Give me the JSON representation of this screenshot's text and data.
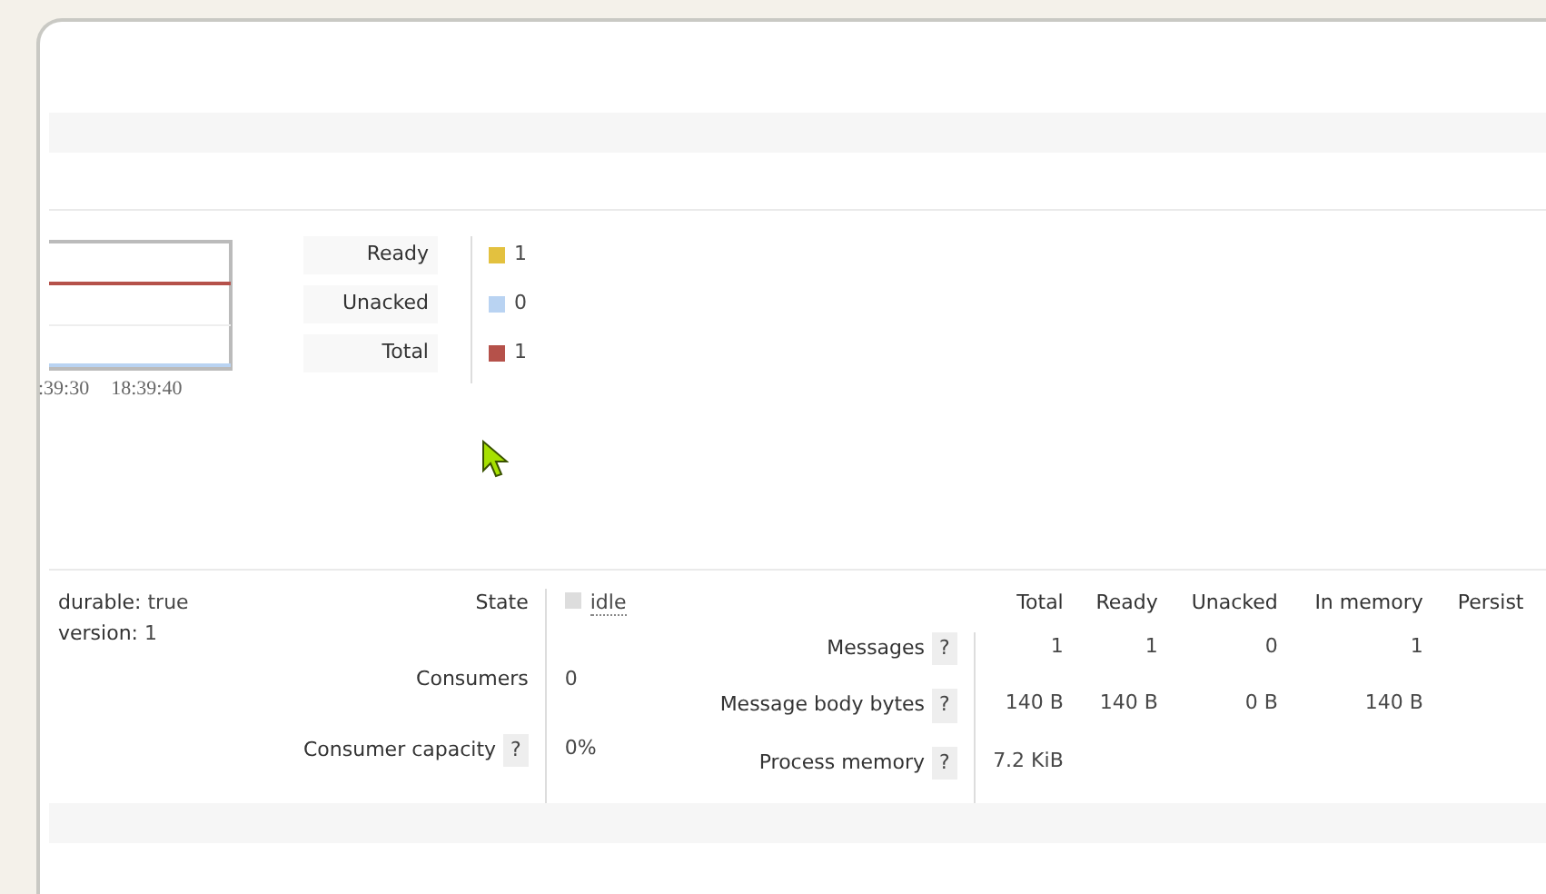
{
  "queue_chart": {
    "tick_labels": [
      ":39:30",
      "18:39:40"
    ],
    "legend": [
      {
        "label": "Ready",
        "value": "1",
        "color": "#e3c13f"
      },
      {
        "label": "Unacked",
        "value": "0",
        "color": "#b9d3f2"
      },
      {
        "label": "Total",
        "value": "1",
        "color": "#b5514a"
      }
    ]
  },
  "features": [
    {
      "label": "durable:",
      "value": "true"
    },
    {
      "label": "version:",
      "value": "1"
    }
  ],
  "status": [
    {
      "label": "State",
      "value": "idle",
      "kind": "state"
    },
    {
      "label": "Consumers",
      "value": "0",
      "kind": "text"
    },
    {
      "label": "Consumer capacity",
      "help": "?",
      "value": "0%",
      "kind": "text"
    }
  ],
  "messages": {
    "columns": [
      "Total",
      "Ready",
      "Unacked",
      "In memory",
      "Persist"
    ],
    "rows": [
      {
        "label": "Messages",
        "help": "?",
        "cells": [
          "1",
          "1",
          "0",
          "1"
        ]
      },
      {
        "label": "Message body bytes",
        "help": "?",
        "cells": [
          "140 B",
          "140 B",
          "0 B",
          "140 B"
        ]
      },
      {
        "label": "Process memory",
        "help": "?",
        "cells": [
          "7.2 KiB"
        ]
      }
    ]
  }
}
